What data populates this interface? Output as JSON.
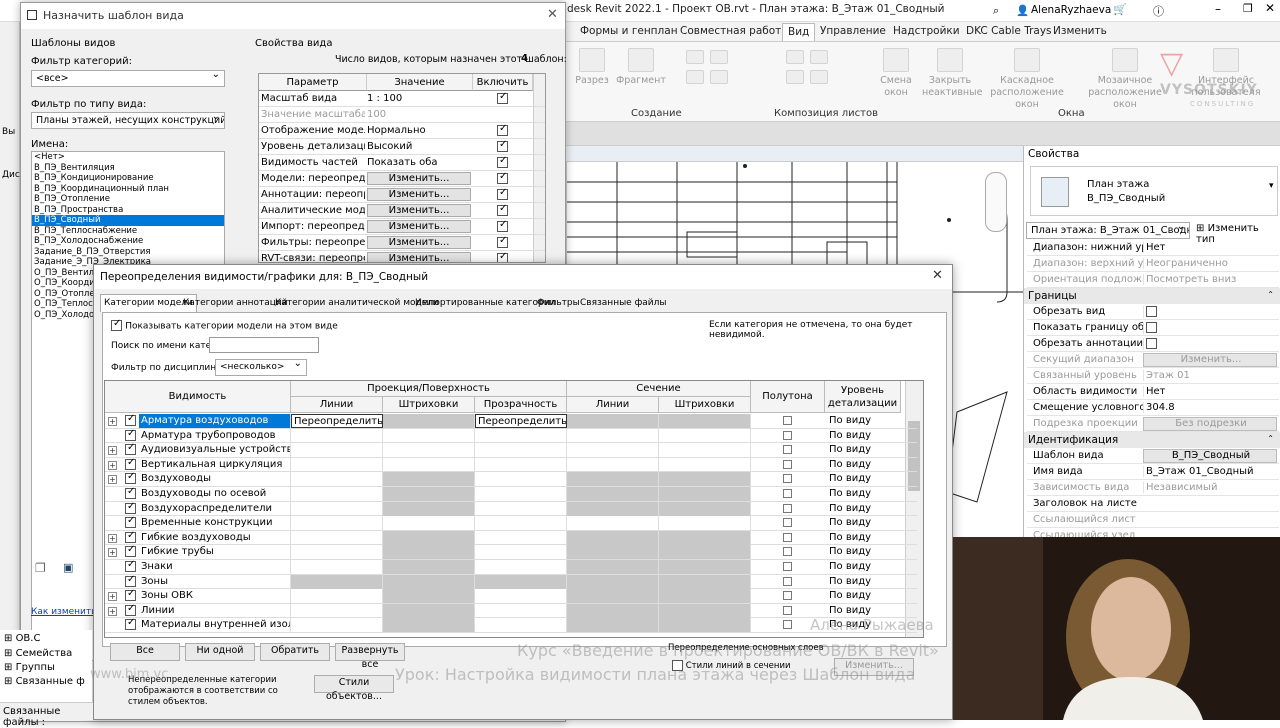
{
  "revit": {
    "title": "desk Revit 2022.1 - Проект ОВ.rvt - План этажа: В_Этаж 01_Сводный",
    "user": "AlenaRyzhaeva",
    "tabs": [
      "Формы и генплан",
      "Совместная работа",
      "Вид",
      "Управление",
      "Надстройки",
      "DKC Cable Trays",
      "Изменить"
    ],
    "ribbon": {
      "btns": [
        "Разрез",
        "Фрагмент",
        "Смена окон",
        "Закрыть неактивные",
        "Каскадное расположение окон",
        "Мозаичное расположение окон",
        "Интерфейс пользователя"
      ],
      "groups": [
        "Создание",
        "Композиция листов",
        "Окна"
      ]
    },
    "status": "Связанные файлы :",
    "browser": {
      "items": [
        "ОВ.С",
        "Семейства",
        "Группы",
        "Связанные ф"
      ]
    },
    "left_labels": [
      "Вы",
      "Дис"
    ]
  },
  "props": {
    "title": "Свойства",
    "type_line1": "План этажа",
    "type_line2": "В_ПЭ_Сводный",
    "selector": "План этажа: В_Этаж 01_Сводный",
    "edit_type": "Изменить тип",
    "rows1": [
      {
        "k": "Диапазон: нижний ур...",
        "v": "Нет",
        "dim": false
      },
      {
        "k": "Диапазон: верхний у...",
        "v": "Неограниченно",
        "dim": true
      },
      {
        "k": "Ориентация подложки",
        "v": "Посмотреть вниз",
        "dim": true
      }
    ],
    "sec_bounds": "Границы",
    "rows2": [
      {
        "k": "Обрезать вид",
        "v": "",
        "chk": true
      },
      {
        "k": "Показать границу об...",
        "v": "",
        "chk": true
      },
      {
        "k": "Обрезать аннотации",
        "v": "",
        "chk": true
      },
      {
        "k": "Секущий диапазон",
        "v": "Изменить...",
        "dim": true,
        "btn": true
      },
      {
        "k": "Связанный уровень",
        "v": "Этаж 01",
        "dim": true
      },
      {
        "k": "Область видимости",
        "v": "Нет"
      },
      {
        "k": "Смещение условного...",
        "v": "304.8"
      },
      {
        "k": "Подрезка проекции",
        "v": "Без подрезки",
        "dim": true,
        "btn": true
      }
    ],
    "sec_id": "Идентификация",
    "rows3": [
      {
        "k": "Шаблон вида",
        "v": "В_ПЭ_Сводный",
        "btn": true
      },
      {
        "k": "Имя вида",
        "v": "В_Этаж 01_Сводный"
      },
      {
        "k": "Зависимость вида",
        "v": "Независимый",
        "dim": true
      },
      {
        "k": "Заголовок на листе",
        "v": ""
      },
      {
        "k": "Ссылающийся лист",
        "v": "",
        "dim": true
      },
      {
        "k": "Ссылающийся узел",
        "v": "",
        "dim": true
      }
    ]
  },
  "tpl": {
    "title": "Назначить шаблон вида",
    "templates_label": "Шаблоны видов",
    "cat_filter_label": "Фильтр категорий:",
    "cat_filter": "<все>",
    "type_filter_label": "Фильтр по типу вида:",
    "type_filter": "Планы этажей, несущих конструкций, зон",
    "names_label": "Имена:",
    "names": [
      "<Нет>",
      "В_ПЭ_Вентиляция",
      "В_ПЭ_Кондиционирование",
      "В_ПЭ_Координационный план",
      "В_ПЭ_Отопление",
      "В_ПЭ_Пространства",
      "В_ПЭ_Сводный",
      "В_ПЭ_Теплоснабжение",
      "В_ПЭ_Холодоснабжение",
      "Задание_В_ПЭ_Отверстия",
      "Задание_Э_ПЭ_Электрика",
      "О_ПЭ_Вентиляция",
      "О_ПЭ_Координационный",
      "О_ПЭ_Отопление",
      "О_ПЭ_Теплоснабжение",
      "О_ПЭ_Холодоснабжение"
    ],
    "selected_index": 6,
    "props_label": "Свойства вида",
    "count_label": "Число видов, которым назначен этот шаблон:",
    "count": "4",
    "cols": [
      "Параметр",
      "Значение",
      "Включить"
    ],
    "rows": [
      {
        "a": "Масштаб вида",
        "b": "1 : 100",
        "c": true
      },
      {
        "a": "Значение масштаба",
        "b": "100",
        "dim": true
      },
      {
        "a": "Отображение модели",
        "b": "Нормально",
        "c": true
      },
      {
        "a": "Уровень детализации",
        "b": "Высокий",
        "c": true
      },
      {
        "a": "Видимость частей",
        "b": "Показать оба",
        "c": true
      },
      {
        "a": "Модели: переопределе",
        "b": "Изменить...",
        "btn": true,
        "c": true
      },
      {
        "a": "Аннотации: переопре",
        "b": "Изменить...",
        "btn": true,
        "c": true
      },
      {
        "a": "Аналитические модел",
        "b": "Изменить...",
        "btn": true,
        "c": true
      },
      {
        "a": "Импорт: переопредел",
        "b": "Изменить...",
        "btn": true,
        "c": true
      },
      {
        "a": "Фильтры: переопреде",
        "b": "Изменить...",
        "btn": true,
        "c": true
      },
      {
        "a": "RVT-связи: переопред",
        "b": "Изменить...",
        "btn": true,
        "c": true
      }
    ],
    "link": "Как изменить ш"
  },
  "vg": {
    "title": "Переопределения видимости/графики для: В_ПЭ_Сводный",
    "tabs": [
      "Категории модели",
      "Категории аннотаций",
      "Категории аналитической модели",
      "Импортированные категории",
      "Фильтры",
      "Связанные файлы"
    ],
    "show_cats": "Показывать категории модели на этом виде",
    "note": "Если категория не отмечена, то она будет невидимой.",
    "search_label": "Поиск по имени катег.:",
    "disc_label": "Фильтр по дисциплинам:",
    "disc": "<несколько>",
    "h_vis": "Видимость",
    "h_proj": "Проекция/Поверхность",
    "h_cut": "Сечение",
    "h_half": "Полутона",
    "h_detail": "Уровень детализации",
    "h_lines": "Линии",
    "h_hatch": "Штриховки",
    "h_transp": "Прозрачность",
    "rows": [
      {
        "n": "Арматура воздуховодов",
        "ov": "Переопределить...",
        "tr": "Переопределить..."
      },
      {
        "n": "Арматура трубопроводов"
      },
      {
        "n": "Аудиовизуальные устройства"
      },
      {
        "n": "Вертикальная циркуляция"
      },
      {
        "n": "Воздуховоды"
      },
      {
        "n": "Воздуховоды по осевой"
      },
      {
        "n": "Воздухораспределители"
      },
      {
        "n": "Временные конструкции"
      },
      {
        "n": "Гибкие воздуховоды"
      },
      {
        "n": "Гибкие трубы"
      },
      {
        "n": "Знаки"
      },
      {
        "n": "Зоны"
      },
      {
        "n": "Зоны ОВК"
      },
      {
        "n": "Линии"
      },
      {
        "n": "Материалы внутренней изол..."
      }
    ],
    "detail_val": "По виду",
    "btns": [
      "Все",
      "Ни одной",
      "Обратить",
      "Развернуть все"
    ],
    "override_lbl": "Переопределение основных слоев",
    "cut_styles": "Стили линий в сечении",
    "change": "Изменить...",
    "non_override": "Непереопределенные категории отображаются в соответствии со стилем объектов.",
    "obj_styles": "Стили объектов..."
  },
  "watermark": {
    "name": "Алена Рыжаева",
    "course": "Курс «Введение в проектирование ОВ/ВК в Revit»",
    "lesson": "Урок: Настройка видимости плана этажа через Шаблон вида",
    "site": "www.bim.vc",
    "logo": "VYSOTSKIY",
    "logo_sub": "CONSULTING"
  }
}
